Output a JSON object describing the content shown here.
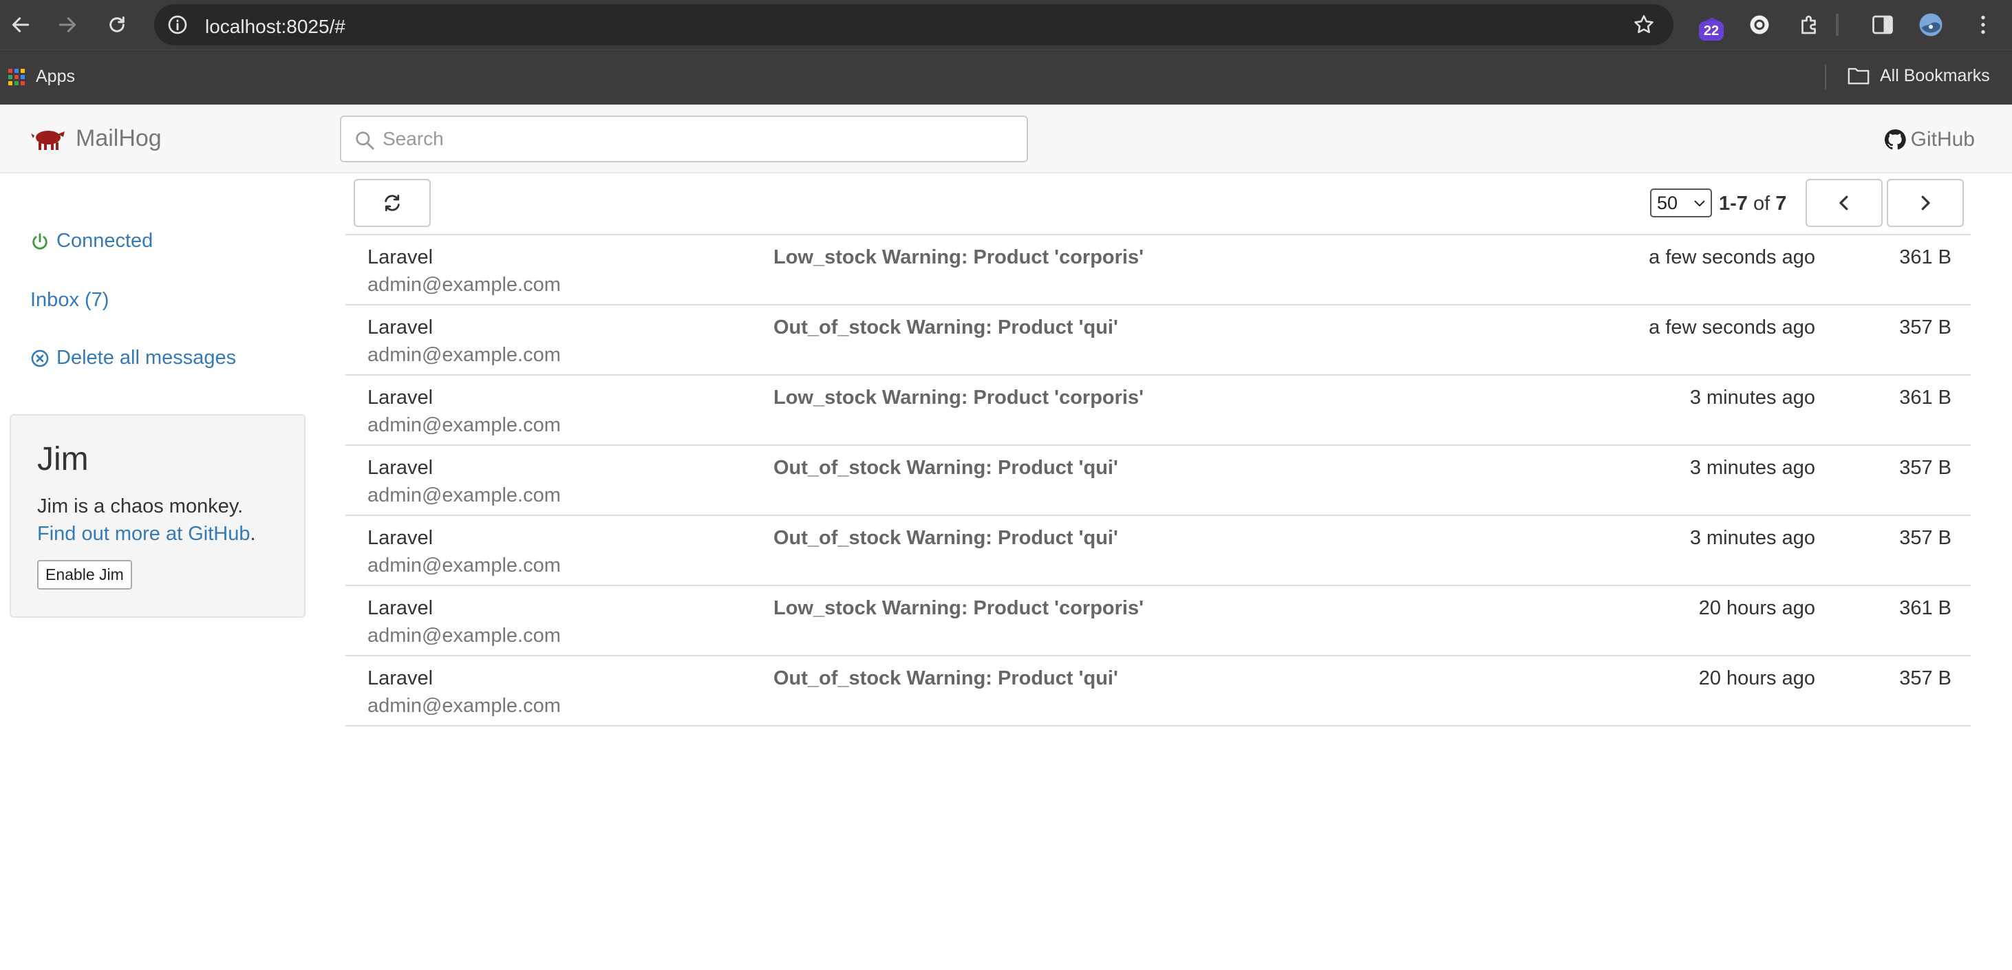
{
  "browser": {
    "url": "localhost:8025/#",
    "extension_badge": "22",
    "bookmarks": {
      "apps_label": "Apps",
      "all_bookmarks_label": "All Bookmarks"
    }
  },
  "app": {
    "brand": "MailHog",
    "search_placeholder": "Search",
    "github_label": "GitHub"
  },
  "sidebar": {
    "connected_label": "Connected",
    "inbox_label": "Inbox (7)",
    "delete_all_label": "Delete all messages",
    "jim": {
      "title": "Jim",
      "description": "Jim is a chaos monkey.",
      "link_text": "Find out more at GitHub",
      "link_suffix": ".",
      "button_label": "Enable Jim"
    }
  },
  "toolbar": {
    "page_size": "50",
    "range_start_end": "1-7",
    "range_of": "of",
    "range_total": "7"
  },
  "messages": [
    {
      "from": "Laravel",
      "address": "admin@example.com",
      "subject": "Low_stock Warning: Product 'corporis'",
      "time": "a few seconds ago",
      "size": "361 B"
    },
    {
      "from": "Laravel",
      "address": "admin@example.com",
      "subject": "Out_of_stock Warning: Product 'qui'",
      "time": "a few seconds ago",
      "size": "357 B"
    },
    {
      "from": "Laravel",
      "address": "admin@example.com",
      "subject": "Low_stock Warning: Product 'corporis'",
      "time": "3 minutes ago",
      "size": "361 B"
    },
    {
      "from": "Laravel",
      "address": "admin@example.com",
      "subject": "Out_of_stock Warning: Product 'qui'",
      "time": "3 minutes ago",
      "size": "357 B"
    },
    {
      "from": "Laravel",
      "address": "admin@example.com",
      "subject": "Out_of_stock Warning: Product 'qui'",
      "time": "3 minutes ago",
      "size": "357 B"
    },
    {
      "from": "Laravel",
      "address": "admin@example.com",
      "subject": "Low_stock Warning: Product 'corporis'",
      "time": "20 hours ago",
      "size": "361 B"
    },
    {
      "from": "Laravel",
      "address": "admin@example.com",
      "subject": "Out_of_stock Warning: Product 'qui'",
      "time": "20 hours ago",
      "size": "357 B"
    }
  ],
  "colors": {
    "chrome_bg": "#3c3c3c",
    "link": "#337ab7",
    "connected_green": "#3c9a3c",
    "brand_pig": "#9b1c1c",
    "badge": "#6a3fd6"
  }
}
